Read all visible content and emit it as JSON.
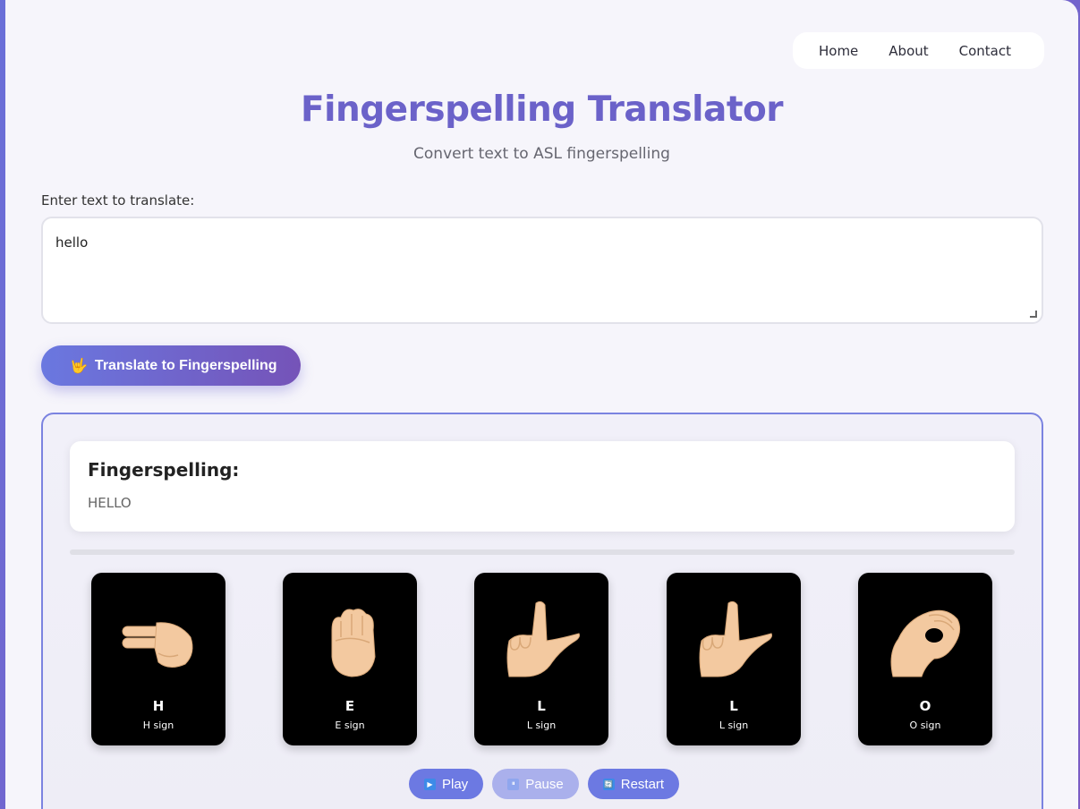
{
  "nav": {
    "items": [
      "Home",
      "About",
      "Contact"
    ]
  },
  "header": {
    "title": "Fingerspelling Translator",
    "subtitle": "Convert text to ASL fingerspelling"
  },
  "input": {
    "label": "Enter text to translate:",
    "value": "hello"
  },
  "translate_button": {
    "icon": "🤟",
    "label": "Translate to Fingerspelling"
  },
  "result": {
    "heading": "Fingerspelling:",
    "text": "HELLO",
    "progress": 0,
    "signs": [
      {
        "letter": "H",
        "caption": "H sign",
        "icon": "hand-sign-h-icon"
      },
      {
        "letter": "E",
        "caption": "E sign",
        "icon": "hand-sign-e-icon"
      },
      {
        "letter": "L",
        "caption": "L sign",
        "icon": "hand-sign-l-icon"
      },
      {
        "letter": "L",
        "caption": "L sign",
        "icon": "hand-sign-l-icon"
      },
      {
        "letter": "O",
        "caption": "O sign",
        "icon": "hand-sign-o-icon"
      }
    ]
  },
  "controls": {
    "play": "Play",
    "pause": "Pause",
    "restart": "Restart",
    "play_icon": "▶",
    "pause_icon": "⏸",
    "restart_icon": "🔄"
  },
  "colors": {
    "accent": "#6b62c9",
    "button": "#6c79e2",
    "panel_border": "#7b83e0",
    "card_bg": "#000000",
    "skin": "#f3c9a0"
  }
}
